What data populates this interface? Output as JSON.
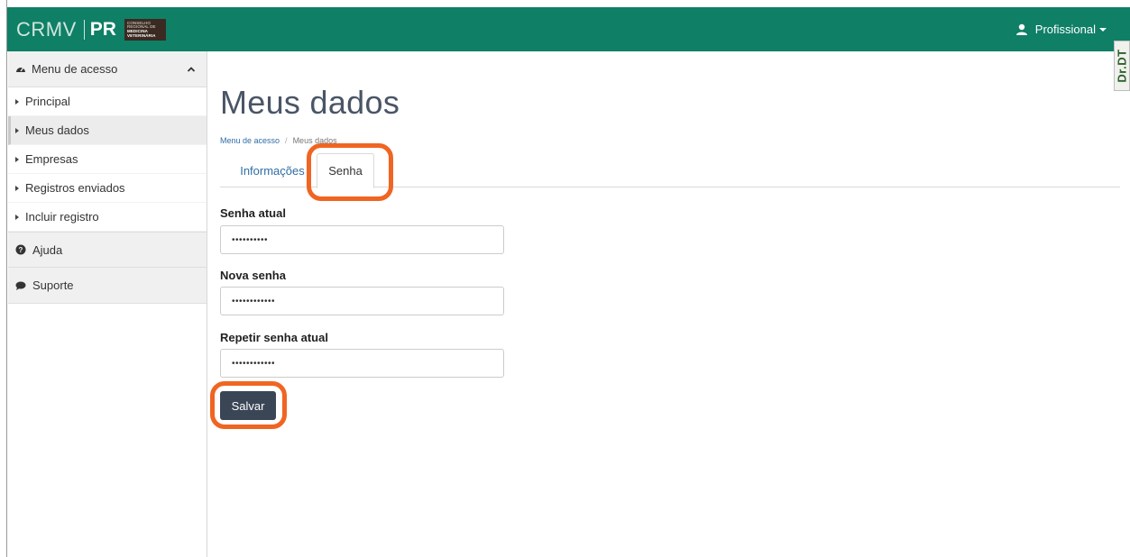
{
  "topbar": {
    "logo": {
      "crmv": "CRMV",
      "pr": "PR",
      "badge_lines": [
        "CONSELHO",
        "REGIONAL DE",
        "MEDICINA",
        "VETERINÁRIA"
      ]
    },
    "user_menu_label": "Profissional",
    "bg_color": "#0f7f66"
  },
  "extension_badge": "Dr.DT",
  "sidebar": {
    "header_label": "Menu de acesso",
    "items": [
      {
        "label": "Principal"
      },
      {
        "label": "Meus dados"
      },
      {
        "label": "Empresas"
      },
      {
        "label": "Registros enviados"
      },
      {
        "label": "Incluir registro"
      }
    ],
    "sections": [
      {
        "label": "Ajuda"
      },
      {
        "label": "Suporte"
      }
    ],
    "active_item": "Meus dados"
  },
  "main": {
    "title": "Meus dados",
    "breadcrumb": [
      "Menu de acesso",
      "Meus dados"
    ],
    "tabs": [
      {
        "label": "Informações"
      },
      {
        "label": "Senha"
      }
    ],
    "active_tab": "Senha",
    "form": {
      "current_password": {
        "label": "Senha atual",
        "value": "••••••••••"
      },
      "new_password": {
        "label": "Nova senha",
        "value": "••••••••••••"
      },
      "repeat_password": {
        "label": "Repetir senha atual",
        "value": "••••••••••••"
      },
      "save_label": "Salvar"
    }
  },
  "annotation_color": "#f06522"
}
